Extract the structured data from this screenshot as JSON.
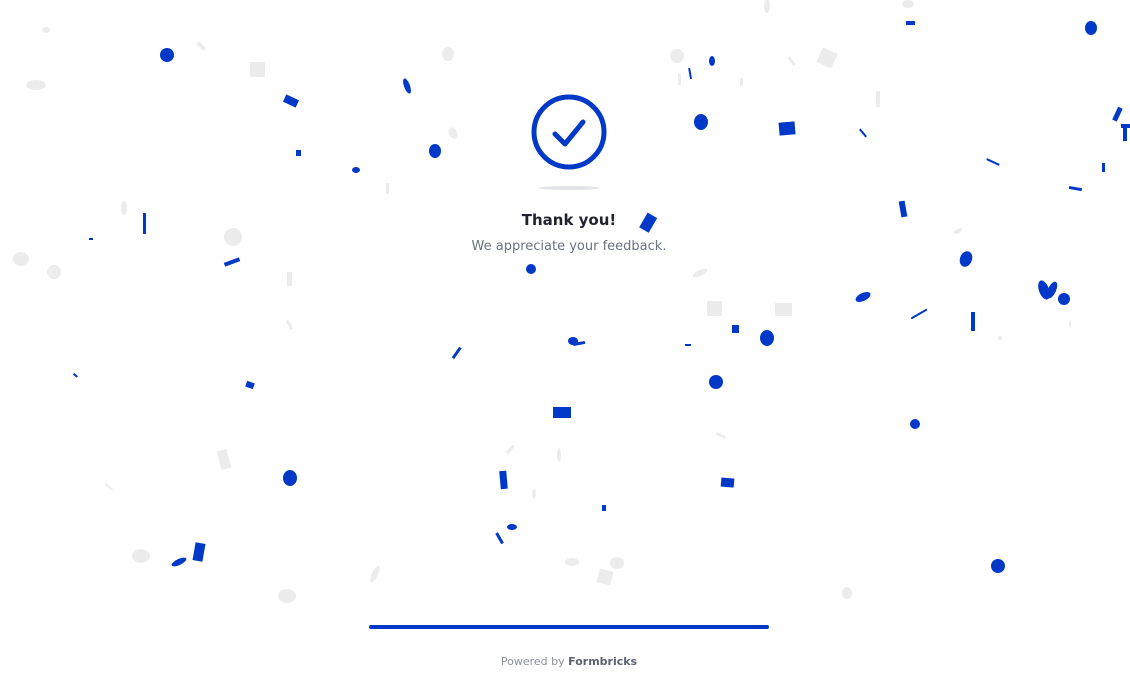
{
  "survey": {
    "title": "Thank you!",
    "subtitle": "We appreciate your feedback.",
    "icon": "check-circle-icon",
    "progress": 1.0
  },
  "footer": {
    "prefix": "Powered by",
    "brand": "Formbricks"
  },
  "colors": {
    "accent": "#0039c7",
    "confetti_secondary": "#ececec",
    "title": "#1f2330",
    "subtitle": "#6b7280"
  },
  "decoration": {
    "confetti": "confetti-icon"
  }
}
